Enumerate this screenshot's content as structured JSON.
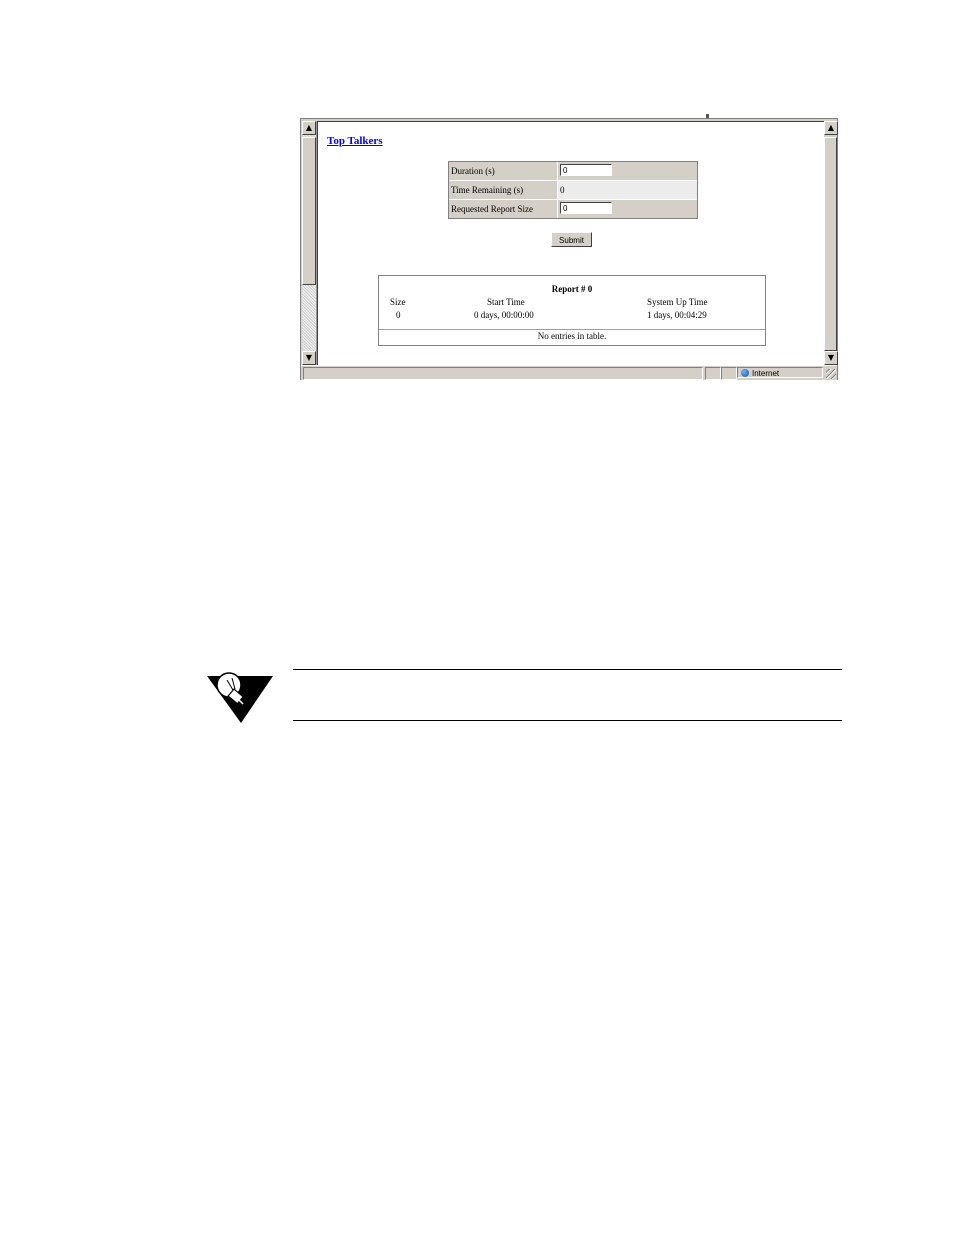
{
  "page": {
    "title_link": "Top Talkers",
    "form": {
      "rows": [
        {
          "label": "Duration (s)",
          "value": "0",
          "editable": true
        },
        {
          "label": "Time Remaining (s)",
          "value": "0",
          "editable": false
        },
        {
          "label": "Requested Report Size",
          "value": "0",
          "editable": true
        }
      ],
      "submit_label": "Submit"
    },
    "report": {
      "title": "Report # 0",
      "columns": [
        "Size",
        "Start Time",
        "System Up Time"
      ],
      "values": [
        "0",
        "0 days, 00:00:00",
        "1 days, 00:04:29"
      ],
      "empty_message": "No entries in table."
    }
  },
  "statusbar": {
    "zone_label": "Internet",
    "zone_icon": "globe-icon"
  },
  "note": {
    "icon": "lightbulb-icon"
  }
}
